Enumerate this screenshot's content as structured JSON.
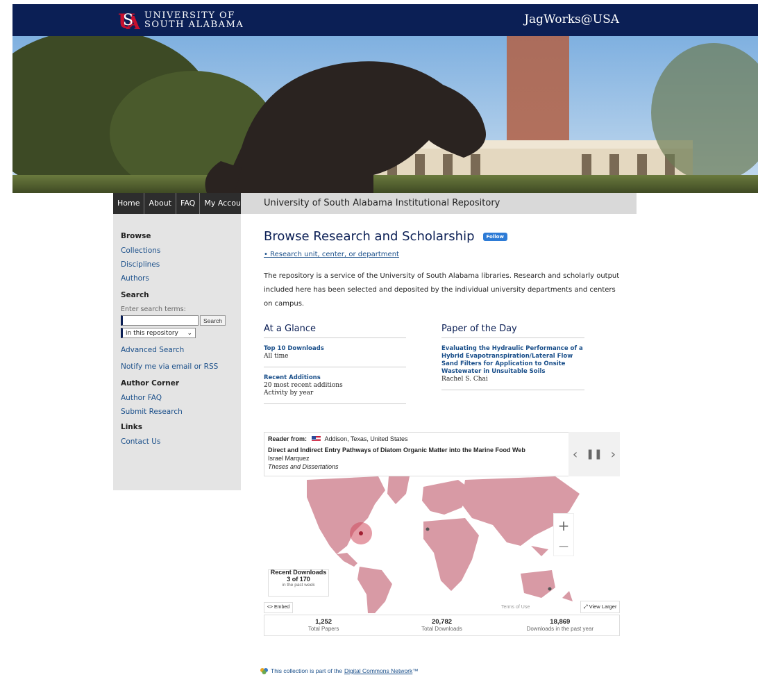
{
  "header": {
    "logo_text_1": "UNIVERSITY OF",
    "logo_text_2": "SOUTH ALABAMA",
    "site_name": "JagWorks@USA"
  },
  "nav": {
    "items": [
      "Home",
      "About",
      "FAQ",
      "My Account"
    ],
    "repo_title": "University of South Alabama Institutional Repository"
  },
  "sidebar": {
    "browse_heading": "Browse",
    "browse_links": [
      "Collections",
      "Disciplines",
      "Authors"
    ],
    "search_heading": "Search",
    "search_hint": "Enter search terms:",
    "search_value": "",
    "search_button": "Search",
    "search_scope": "in this repository",
    "advanced_search": "Advanced Search",
    "notify": "Notify me via email or RSS",
    "author_heading": "Author Corner",
    "author_links": [
      "Author FAQ",
      "Submit Research"
    ],
    "links_heading": "Links",
    "contact": "Contact Us"
  },
  "main": {
    "title": "Browse Research and Scholarship",
    "follow": "Follow",
    "subnav": "• Research unit, center, or department",
    "intro": "The repository is a service of the University of South Alabama libraries. Research and scholarly output included here has been selected and deposited by the individual university departments and centers on campus."
  },
  "glance": {
    "heading": "At a Glance",
    "top10": "Top 10 Downloads",
    "top10_sub": "All time",
    "recent": "Recent Additions",
    "recent_sub1": "20 most recent additions",
    "recent_sub2": "Activity by year"
  },
  "potd": {
    "heading": "Paper of the Day",
    "paper_title": "Evaluating the Hydraulic Performance of a Hybrid Evapotranspiration/Lateral Flow Sand Filters for Application to Onsite Wastewater in Unsuitable Soils",
    "author": "Rachel S. Chai"
  },
  "widget": {
    "reader_label": "Reader from:",
    "reader_location": "Addison, Texas, United States",
    "item_title": "Direct and Indirect Entry Pathways of Diatom Organic Matter into the Marine Food Web",
    "item_author": "Israel Marquez",
    "item_collection": "Theses and Dissertations",
    "recent_title": "Recent Downloads",
    "recent_count": "3 of 170",
    "recent_period": "in the past week",
    "embed": "<> Embed",
    "terms": "Terms of Use",
    "view_larger": "View Larger",
    "zoom_in": "+",
    "zoom_out": "—",
    "stats": [
      {
        "value": "1,252",
        "label": "Total Papers"
      },
      {
        "value": "20,782",
        "label": "Total Downloads"
      },
      {
        "value": "18,869",
        "label": "Downloads in the past year"
      }
    ]
  },
  "footer": {
    "text": "This collection is part of the",
    "link": "Digital Commons Network",
    "tm": "™"
  },
  "colors": {
    "navy": "#0b1f55",
    "usa_red": "#c8102e",
    "link_blue": "#1a4f8a",
    "map_land": "#d89aa5"
  }
}
